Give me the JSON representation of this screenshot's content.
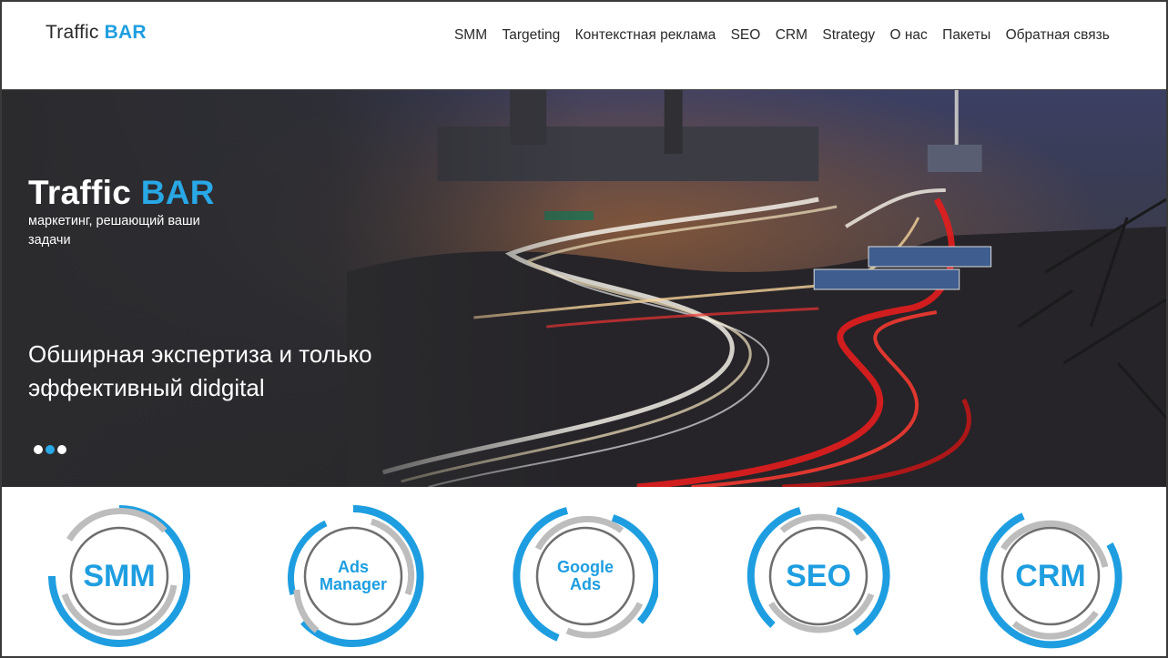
{
  "header": {
    "logo_main": "Traffic",
    "logo_accent": "BAR",
    "nav": [
      "SMM",
      "Targeting",
      "Контекстная реклама",
      "SEO",
      "CRM",
      "Strategy",
      "О нас",
      "Пакеты",
      "Обратная связь"
    ]
  },
  "hero": {
    "title_main": "Traffic",
    "title_accent": "BAR",
    "subtitle": "маркетинг, решающий ваши задачи",
    "tagline": "Обширная экспертиза и только эффективный didgital",
    "slides": 3,
    "active_slide": 2
  },
  "services": [
    {
      "label": "SMM"
    },
    {
      "label": "Ads\nManager"
    },
    {
      "label": "Google\nAds"
    },
    {
      "label": "SEO"
    },
    {
      "label": "CRM"
    }
  ],
  "colors": {
    "accent": "#1e9ee0",
    "ring_gray": "#bdbdbd",
    "ring_dark": "#6e6e6e",
    "hero_bg": "#2a2a2e"
  }
}
